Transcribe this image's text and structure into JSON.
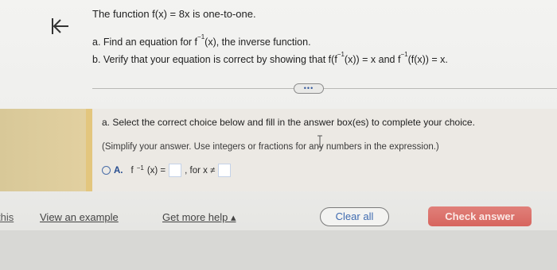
{
  "question": {
    "title": "The function f(x) = 8x is one-to-one.",
    "part_a": "a. Find an equation for f",
    "part_a_sup": "−1",
    "part_a_rest": "(x), the inverse function.",
    "part_b_1": "b. Verify that your equation is correct by showing that f(f",
    "part_b_sup1": "−1",
    "part_b_2": "(x)) = x and f",
    "part_b_sup2": "−1",
    "part_b_3": "(f(x)) = x."
  },
  "more_pill": "•••",
  "answer": {
    "instruction": "a. Select the correct choice below and fill in the answer box(es) to complete your choice.",
    "simplify": "(Simplify your answer. Use integers or fractions for any numbers in the expression.)",
    "choice_letter": "A.",
    "choice_f": "f",
    "choice_sup": "−1",
    "choice_eq": "(x) =",
    "choice_for": ", for x ≠"
  },
  "footer": {
    "cut_label": "this",
    "view_example": "View an example",
    "get_help": "Get more help ▴",
    "clear_all": "Clear all",
    "check_answer": "Check answer"
  }
}
